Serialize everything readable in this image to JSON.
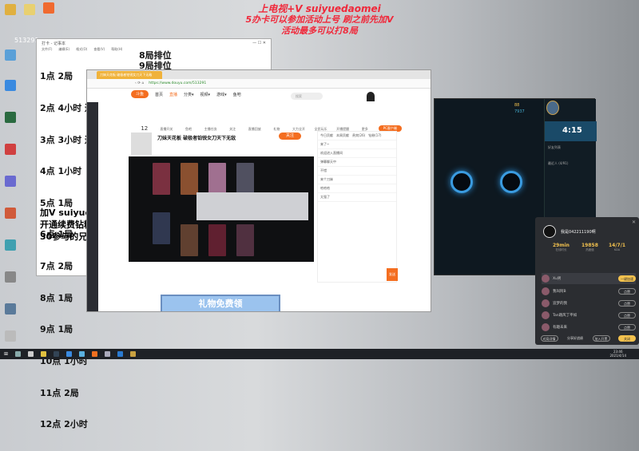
{
  "overlay": {
    "line1": "上电视+V suiyuedaomei",
    "line2": "5办卡可以参加活动上号 刷之前先加V",
    "line3": "活动最多可以打8局"
  },
  "desktop": {
    "room_id": "513291"
  },
  "notepad": {
    "title": "打卡 - 记事本",
    "menu": [
      "文件(F)",
      "编辑(E)",
      "格式(O)",
      "查看(V)",
      "帮助(H)"
    ],
    "lines": [
      "1点 2局",
      "2点 4小时 送4张办卡",
      "3点 3小时 送",
      "4点 1小时",
      "5点 1局",
      "6点 1局",
      "7点 2局",
      "8点 1局",
      "9点 1局",
      "10点 1小时",
      "11点 2局",
      "12点 2小时"
    ],
    "right_lines": [
      "8局排位",
      "9局排位"
    ],
    "bottom_lines": [
      "加V  suiyued",
      "开通续费钻粉",
      "30参与的兄弟"
    ]
  },
  "browser": {
    "url": "https://www.douyu.com/513291",
    "nav": [
      "首页",
      "直播",
      "分类▾",
      "视频▾",
      "游戏▾",
      "鱼吧"
    ],
    "logo": "斗鱼",
    "search_placeholder": "搜索",
    "tools": [
      "12",
      "直播开关",
      "鱼吧",
      "主播任务",
      "关注",
      "直播回放",
      "礼物",
      "大力全开",
      "全民玩乐",
      "开播提醒",
      "更多"
    ],
    "stream_title": "刀妹天花板 破极者铂锐女刀天下无敌",
    "follow": "关注",
    "pc_client": "PC客户端",
    "chat_tabs": [
      "今日贡献",
      "本周贡献",
      "贵宾(26)",
      "钻粉(17)"
    ],
    "chat": [
      "来了~",
      "欢迎进入直播间",
      "弹幕聊天中",
      "不错",
      "来个刀妹",
      "哈哈哈",
      "太强了"
    ],
    "send": "发送",
    "banner": "礼物免费领"
  },
  "client": {
    "currency1": "88",
    "currency2": "7937",
    "timer": "4:15",
    "friends_header": "好友列表",
    "group": "最近人 (4/91)"
  },
  "popup": {
    "name": "我是042211190啊",
    "stats": [
      {
        "value": "29min",
        "label": "在线时长"
      },
      {
        "value": "19858",
        "label": "热度值"
      },
      {
        "value": "14/7/1",
        "label": "KDA"
      }
    ],
    "players": [
      {
        "name": "Xu男",
        "btn": "一键加速"
      },
      {
        "name": "我叫阿B",
        "btn": "点赞"
      },
      {
        "name": "追梦的我",
        "btn": "点赞"
      },
      {
        "name": "Tan踏风丁平如",
        "btn": "点赞"
      },
      {
        "name": "有趣未来",
        "btn": "点赞"
      }
    ],
    "buttons": [
      "对局详情",
      "分享好战绩",
      "加入开黑",
      "关闭"
    ]
  },
  "taskbar": {
    "time": "23:46",
    "date": "2021/4/14"
  }
}
